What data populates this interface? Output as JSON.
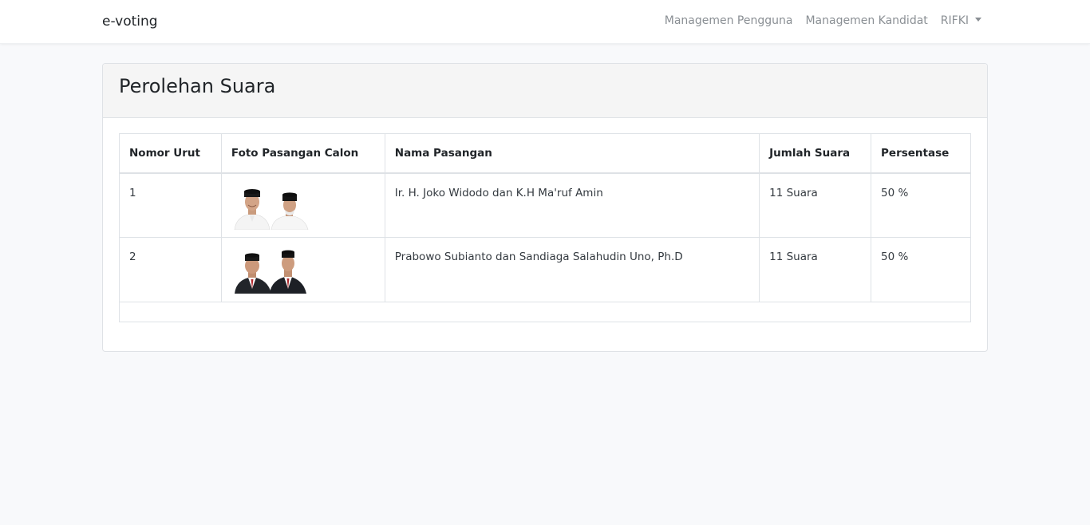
{
  "navbar": {
    "brand": "e-voting",
    "links": [
      "Managemen Pengguna",
      "Managemen Kandidat"
    ],
    "user": "RIFKI"
  },
  "card": {
    "title": "Perolehan Suara"
  },
  "table": {
    "headers": [
      "Nomor Urut",
      "Foto Pasangan Calon",
      "Nama Pasangan",
      "Jumlah Suara",
      "Persentase"
    ],
    "rows": [
      {
        "nomor": "1",
        "photo_icon": "candidate-pair-photo-1",
        "nama": "Ir. H. Joko Widodo dan K.H Ma'ruf Amin",
        "jumlah": "11 Suara",
        "persentase": "50 %"
      },
      {
        "nomor": "2",
        "photo_icon": "candidate-pair-photo-2",
        "nama": "Prabowo Subianto dan Sandiaga Salahudin Uno, Ph.D",
        "jumlah": "11 Suara",
        "persentase": "50 %"
      }
    ]
  }
}
